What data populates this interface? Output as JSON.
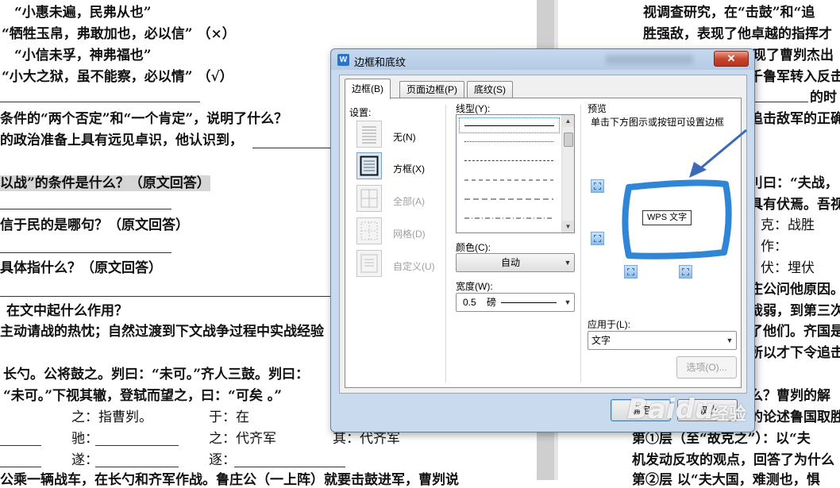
{
  "document": {
    "left_lines": [
      "“小惠未遍，民弗从也”",
      "“牺牲玉帛，弗敢加也，必以信”  （×）",
      "“小信未孚，神弗福也”",
      "“小大之狱，虽不能察，必以情”  （√）",
      "条件的“两个否定”和“一个肯定”，说明了什么？",
      "的政治准备上具有远见卓识，他认识到，",
      "以战”的条件是什么？（原文回答）",
      "信于民的是哪句？（原文回答）",
      "具体指什么？（原文回答）",
      "在文中起什么作用？",
      "主动请战的热忱；自然过渡到下文战争过程中实战经验",
      "长勺。公将鼓之。刿曰：“未可。”齐人三鼓。刿曰：",
      "“未可。”下视其辙，登轼而望之，曰：“可矣 。”",
      "之：指曹刿。",
      "于：在",
      "驰：",
      "之：代齐军",
      "遂：",
      "逐：",
      "其：代齐军",
      "公乘一辆战车，在长勺和齐军作战。鲁庄公（一上阵）就要击鼓进军，曹刿说"
    ],
    "right_lines": [
      "视调查研究，在“击鼓”和“追",
      "胜强敌，表现了他卓越的指挥才",
      "现了曹刿杰出",
      "千鲁军转入反击",
      "的时",
      "追击敌军的正确",
      "刂曰：“夫战，",
      "具有伏焉。吾视",
      "克：战胜",
      "作：",
      "伏：埋伏",
      "庄公问他原因。",
      "哉弱，到第三次",
      "了他们。齐国是",
      "所以才下令追击",
      "么？曹刿的解",
      "的论述鲁国取胜",
      "第①层（至“故克之”）：以“夫",
      "机发动反攻的观点，回答了为什么",
      "第②层 以“夫大国，难测也，惧"
    ]
  },
  "dialog": {
    "title": "边框和底纹",
    "app_icon_letter": "W",
    "close_symbol": "✕",
    "tabs": [
      "边框(B)",
      "页面边框(P)",
      "底纹(S)"
    ],
    "settings": {
      "label": "设置:",
      "items": [
        "无(N)",
        "方框(X)",
        "全部(A)",
        "网格(D)",
        "自定义(U)"
      ]
    },
    "line_style": {
      "label": "线型(Y):"
    },
    "color": {
      "label": "颜色(C):",
      "value": "自动"
    },
    "width": {
      "label": "宽度(W):",
      "value": "0.5",
      "unit": "磅"
    },
    "preview": {
      "label": "预览",
      "hint": "单击下方图示或按钮可设置边框",
      "sample_text": "WPS 文字"
    },
    "apply_to": {
      "label": "应用于(L):",
      "value": "文字"
    },
    "options_button": "选项(O)...",
    "ok_button": "确定",
    "cancel_button": "取消"
  },
  "watermark": {
    "brand": "Baidu",
    "suffix": "经验"
  },
  "colors": {
    "annotation": "#2f85d6",
    "close_button": "#c8452e"
  }
}
